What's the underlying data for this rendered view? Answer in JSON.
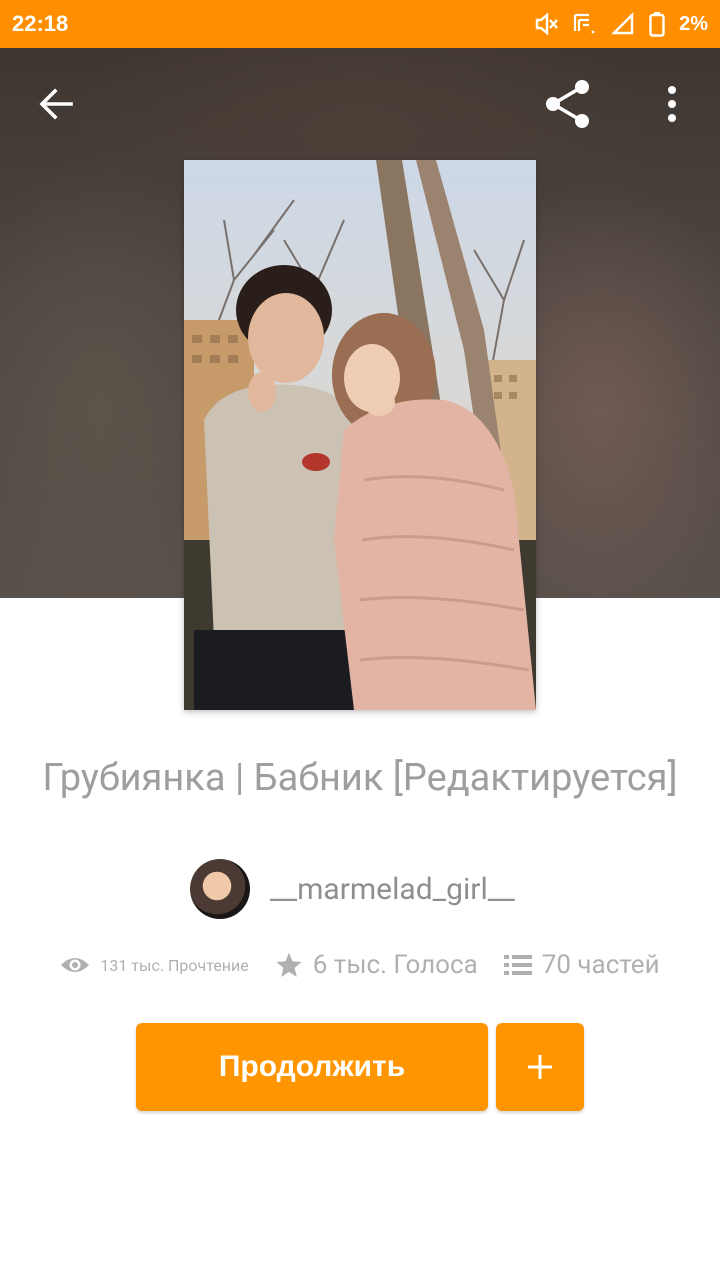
{
  "status_bar": {
    "time": "22:18",
    "battery": "2%",
    "icons": [
      "mute-icon",
      "signal-4g-icon",
      "cell-signal-icon",
      "battery-icon"
    ],
    "background": "#ff8f00"
  },
  "toolbar": {
    "icons": [
      "back-arrow-icon",
      "share-icon",
      "more-vert-icon"
    ]
  },
  "story": {
    "title": "Грубиянка | Бабник [Редактируется]",
    "author": "__marmelad_girl__",
    "stats": {
      "reads": "131 тыс. Прочтение",
      "votes": "6 тыс. Голоса",
      "parts": "70 частей"
    }
  },
  "actions": {
    "continue_label": "Продолжить",
    "add_icon": "plus-icon",
    "accent": "#ff9500"
  }
}
